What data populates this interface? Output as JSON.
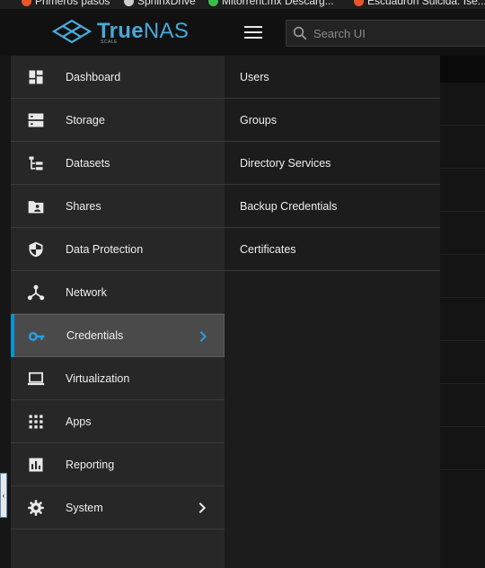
{
  "bookmarks": [
    {
      "label": "Primeros pasos",
      "color": "#e8572a"
    },
    {
      "label": "SphinxDrive",
      "color": "#dddddd"
    },
    {
      "label": "Mitorrent.mx Descarg...",
      "color": "#3bbd4a"
    },
    {
      "label": "Escuadrón Suicida: Ise...",
      "color": "#e8572a"
    }
  ],
  "app": {
    "logo_text_bold": "True",
    "logo_text_rest": "NAS",
    "logo_subtext": "SCALE",
    "accent": "#0095d5"
  },
  "search": {
    "placeholder": "Search UI"
  },
  "sidebar": {
    "items": [
      {
        "label": "Dashboard",
        "icon": "dashboard-icon"
      },
      {
        "label": "Storage",
        "icon": "storage-icon"
      },
      {
        "label": "Datasets",
        "icon": "datasets-icon"
      },
      {
        "label": "Shares",
        "icon": "shares-icon"
      },
      {
        "label": "Data Protection",
        "icon": "data-protection-icon"
      },
      {
        "label": "Network",
        "icon": "network-icon"
      },
      {
        "label": "Credentials",
        "icon": "key-icon",
        "active": true
      },
      {
        "label": "Virtualization",
        "icon": "laptop-icon"
      },
      {
        "label": "Apps",
        "icon": "apps-grid-icon"
      },
      {
        "label": "Reporting",
        "icon": "reporting-icon"
      },
      {
        "label": "System",
        "icon": "gear-icon"
      }
    ]
  },
  "credentials_submenu": {
    "items": [
      {
        "label": "Users"
      },
      {
        "label": "Groups"
      },
      {
        "label": "Directory Services"
      },
      {
        "label": "Backup Credentials"
      },
      {
        "label": "Certificates"
      }
    ]
  }
}
